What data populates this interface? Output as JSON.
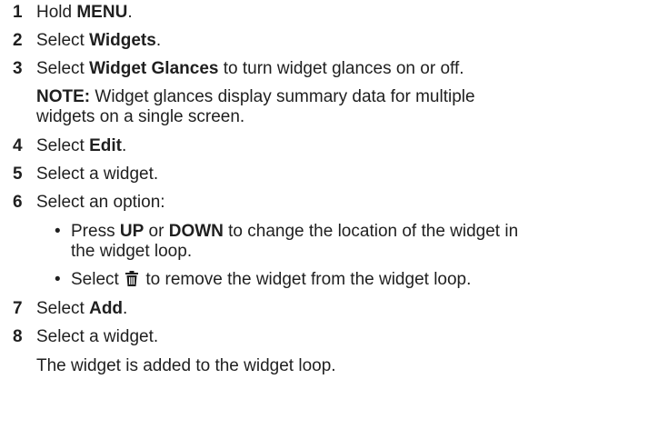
{
  "steps": [
    {
      "num": "1",
      "pre": "Hold ",
      "bold": "MENU",
      "post": "."
    },
    {
      "num": "2",
      "pre": "Select ",
      "bold": "Widgets",
      "post": "."
    },
    {
      "num": "3",
      "pre": "Select ",
      "bold": "Widget Glances",
      "post": " to turn widget glances on or off."
    },
    {
      "num": "4",
      "pre": "Select ",
      "bold": "Edit",
      "post": "."
    },
    {
      "num": "5",
      "text": "Select a widget."
    },
    {
      "num": "6",
      "text": "Select an option:"
    },
    {
      "num": "7",
      "pre": "Select ",
      "bold": "Add",
      "post": "."
    },
    {
      "num": "8",
      "text": "Select a widget."
    }
  ],
  "note": {
    "label": "NOTE:",
    "line1": " Widget glances display summary data for multiple",
    "line2": "widgets on a single screen."
  },
  "options": [
    {
      "bullet": "•",
      "pre": "Press ",
      "bold1": "UP",
      "mid": " or ",
      "bold2": "DOWN",
      "post_line1": " to change the location of the widget in",
      "line2": "the widget loop."
    },
    {
      "bullet": "•",
      "pre": "Select ",
      "icon": "trash-icon",
      "post": " to remove the widget from the widget loop."
    }
  ],
  "result": "The widget is added to the widget loop."
}
